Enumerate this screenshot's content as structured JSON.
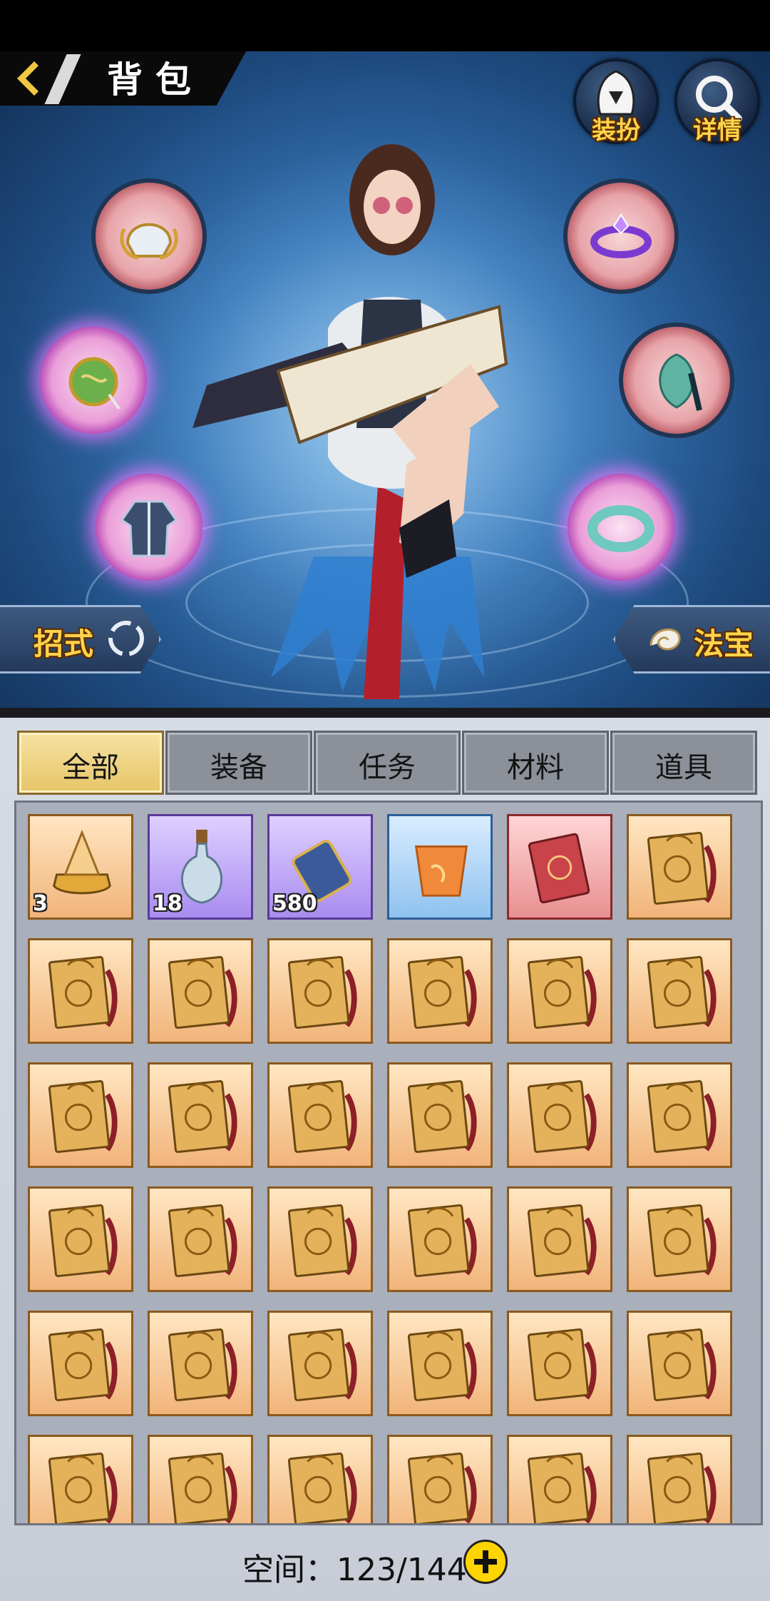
{
  "header": {
    "title": "背包",
    "back_icon": "back-chevron-icon"
  },
  "top_buttons": [
    {
      "label": "装扮",
      "icon": "hooded-figure-icon"
    },
    {
      "label": "详情",
      "icon": "magnifier-icon"
    }
  ],
  "equipment_slots": [
    {
      "icon": "helmet-icon",
      "quality": "normal"
    },
    {
      "icon": "gem-ring-icon",
      "quality": "normal"
    },
    {
      "icon": "jade-pouch-icon",
      "quality": "purple"
    },
    {
      "icon": "jade-pendant-icon",
      "quality": "normal"
    },
    {
      "icon": "robe-icon",
      "quality": "purple"
    },
    {
      "icon": "jade-bracelet-icon",
      "quality": "purple"
    }
  ],
  "side_tabs": {
    "left_label": "招式",
    "left_icon": "swirl-icon",
    "right_label": "法宝",
    "right_icon": "conch-icon"
  },
  "tabs": [
    {
      "label": "全部",
      "active": true
    },
    {
      "label": "装备",
      "active": false
    },
    {
      "label": "任务",
      "active": false
    },
    {
      "label": "材料",
      "active": false
    },
    {
      "label": "道具",
      "active": false
    }
  ],
  "items": [
    {
      "icon": "gold-crown-icon",
      "quality": "orange",
      "count": "3"
    },
    {
      "icon": "porcelain-bottle-icon",
      "quality": "purple",
      "count": "18"
    },
    {
      "icon": "scroll-icon",
      "quality": "purple",
      "count": "580"
    },
    {
      "icon": "sky-lantern-icon",
      "quality": "blue",
      "count": ""
    },
    {
      "icon": "red-book-icon",
      "quality": "red",
      "count": ""
    },
    {
      "icon": "skill-book-icon",
      "quality": "orange",
      "count": ""
    },
    {
      "icon": "skill-book-icon",
      "quality": "orange",
      "count": ""
    },
    {
      "icon": "skill-book-icon",
      "quality": "orange",
      "count": ""
    },
    {
      "icon": "skill-book-icon",
      "quality": "orange",
      "count": ""
    },
    {
      "icon": "skill-book-icon",
      "quality": "orange",
      "count": ""
    },
    {
      "icon": "skill-book-icon",
      "quality": "orange",
      "count": ""
    },
    {
      "icon": "skill-book-icon",
      "quality": "orange",
      "count": ""
    },
    {
      "icon": "skill-book-icon",
      "quality": "orange",
      "count": ""
    },
    {
      "icon": "skill-book-icon",
      "quality": "orange",
      "count": ""
    },
    {
      "icon": "skill-book-icon",
      "quality": "orange",
      "count": ""
    },
    {
      "icon": "skill-book-icon",
      "quality": "orange",
      "count": ""
    },
    {
      "icon": "skill-book-icon",
      "quality": "orange",
      "count": ""
    },
    {
      "icon": "skill-book-icon",
      "quality": "orange",
      "count": ""
    },
    {
      "icon": "skill-book-icon",
      "quality": "orange",
      "count": ""
    },
    {
      "icon": "skill-book-icon",
      "quality": "orange",
      "count": ""
    },
    {
      "icon": "skill-book-icon",
      "quality": "orange",
      "count": ""
    },
    {
      "icon": "skill-book-icon",
      "quality": "orange",
      "count": ""
    },
    {
      "icon": "skill-book-icon",
      "quality": "orange",
      "count": ""
    },
    {
      "icon": "skill-book-icon",
      "quality": "orange",
      "count": ""
    },
    {
      "icon": "skill-book-icon",
      "quality": "orange",
      "count": ""
    },
    {
      "icon": "skill-book-icon",
      "quality": "orange",
      "count": ""
    },
    {
      "icon": "skill-book-icon",
      "quality": "orange",
      "count": ""
    },
    {
      "icon": "skill-book-icon",
      "quality": "orange",
      "count": ""
    },
    {
      "icon": "skill-book-icon",
      "quality": "orange",
      "count": ""
    },
    {
      "icon": "skill-book-icon",
      "quality": "orange",
      "count": ""
    },
    {
      "icon": "skill-book-icon",
      "quality": "orange",
      "count": ""
    },
    {
      "icon": "skill-book-icon",
      "quality": "orange",
      "count": ""
    },
    {
      "icon": "skill-book-icon",
      "quality": "orange",
      "count": ""
    },
    {
      "icon": "skill-book-icon",
      "quality": "orange",
      "count": ""
    },
    {
      "icon": "skill-book-icon",
      "quality": "orange",
      "count": ""
    },
    {
      "icon": "skill-book-icon",
      "quality": "orange",
      "count": ""
    },
    {
      "icon": "skill-book-icon",
      "quality": "orange",
      "count": ""
    },
    {
      "icon": "skill-book-icon",
      "quality": "orange",
      "count": ""
    },
    {
      "icon": "skill-book-icon",
      "quality": "orange",
      "count": ""
    },
    {
      "icon": "skill-book-icon",
      "quality": "orange",
      "count": ""
    },
    {
      "icon": "skill-book-icon",
      "quality": "orange",
      "count": ""
    },
    {
      "icon": "skill-book-icon",
      "quality": "orange",
      "count": ""
    }
  ],
  "footer": {
    "capacity_text": "空间：123/144",
    "add_icon": "plus-circle-icon"
  }
}
